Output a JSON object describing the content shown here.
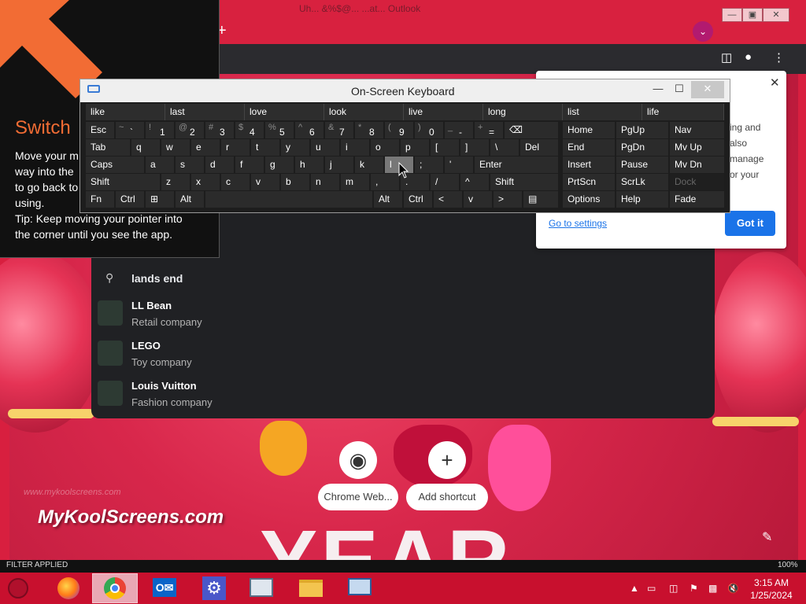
{
  "chrome": {
    "title": "Uh... &%$@... ...at... Outlook",
    "tab_dropdown_icon": "chevron-down-icon"
  },
  "switch_panel": {
    "title": "Switch",
    "body_lines": [
      "Move your m",
      "way into the",
      "to go back to",
      "using.",
      "Tip: Keep moving your pointer into",
      "the corner until you see the app."
    ]
  },
  "osk": {
    "title": "On-Screen Keyboard",
    "predictions": [
      "like",
      "last",
      "love",
      "look",
      "live",
      "long",
      "list",
      "life"
    ],
    "row1": [
      {
        "sup": "",
        "main": "Esc"
      },
      {
        "sup": "~",
        "main": "`"
      },
      {
        "sup": "!",
        "main": "1"
      },
      {
        "sup": "@",
        "main": "2"
      },
      {
        "sup": "#",
        "main": "3"
      },
      {
        "sup": "$",
        "main": "4"
      },
      {
        "sup": "%",
        "main": "5"
      },
      {
        "sup": "^",
        "main": "6"
      },
      {
        "sup": "&",
        "main": "7"
      },
      {
        "sup": "*",
        "main": "8"
      },
      {
        "sup": "(",
        "main": "9"
      },
      {
        "sup": ")",
        "main": "0"
      },
      {
        "sup": "_",
        "main": "-"
      },
      {
        "sup": "+",
        "main": "="
      }
    ],
    "row2": [
      "Tab",
      "q",
      "w",
      "e",
      "r",
      "t",
      "y",
      "u",
      "i",
      "o",
      "p",
      "[",
      "]",
      "\\",
      "Del"
    ],
    "row3": [
      "Caps",
      "a",
      "s",
      "d",
      "f",
      "g",
      "h",
      "j",
      "k",
      "l",
      ";",
      "'",
      "Enter"
    ],
    "row4": [
      "Shift",
      "z",
      "x",
      "c",
      "v",
      "b",
      "n",
      "m",
      ",",
      ".",
      "/",
      "^",
      "Shift"
    ],
    "row5": [
      "Fn",
      "Ctrl",
      "Alt",
      "Alt",
      "Ctrl",
      "<",
      "v",
      ">"
    ],
    "nav_keys": [
      [
        "Home",
        "PgUp",
        "Nav"
      ],
      [
        "End",
        "PgDn",
        "Mv Up"
      ],
      [
        "Insert",
        "Pause",
        "Mv Dn"
      ],
      [
        "PrtScn",
        "ScrLk",
        "Dock"
      ],
      [
        "Options",
        "Help",
        "Fade"
      ]
    ]
  },
  "suggestions": {
    "query": "lands end",
    "items": [
      {
        "name": "LL Bean",
        "sub": "Retail company"
      },
      {
        "name": "LEGO",
        "sub": "Toy company"
      },
      {
        "name": "Louis Vuitton",
        "sub": "Fashion company"
      }
    ]
  },
  "popup": {
    "lines": [
      "ing and",
      "also",
      "manage",
      "or your"
    ],
    "link": "Go to settings",
    "button": "Got it"
  },
  "shortcuts": [
    {
      "label": "Chrome Web..."
    },
    {
      "label": "Add shortcut"
    }
  ],
  "watermark": "MyKoolScreens.com",
  "status_strip": {
    "left": "FILTER APPLIED",
    "right": "100%"
  },
  "clock": {
    "time": "3:15 AM",
    "date": "1/25/2024"
  }
}
